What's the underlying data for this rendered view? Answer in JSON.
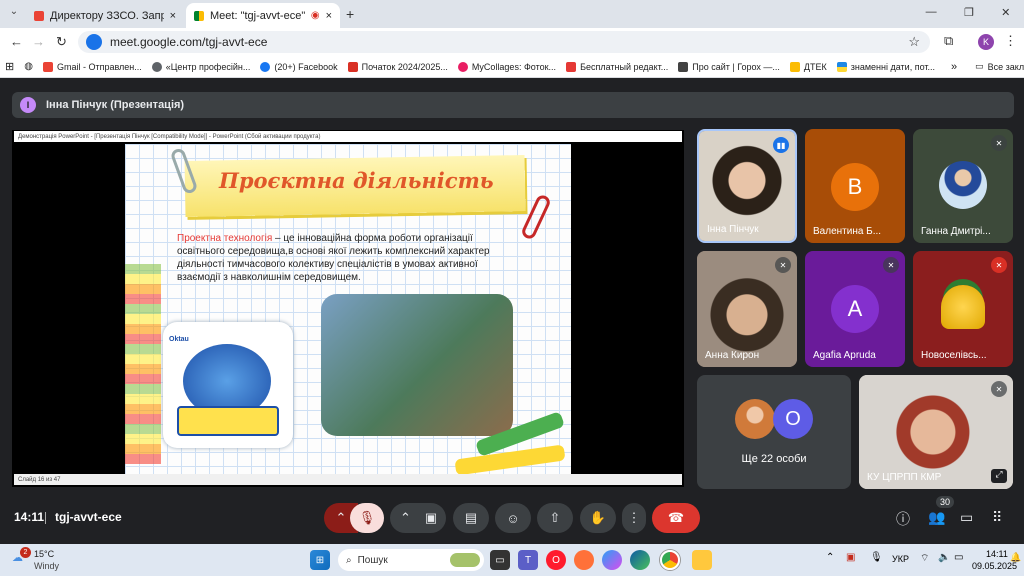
{
  "browser": {
    "tabs": [
      {
        "title": "Директору ЗЗСО. Запрошення",
        "close": "×"
      },
      {
        "title": "Meet: \"tgj-avvt-ece\"",
        "close": "×"
      }
    ],
    "new_tab": "+",
    "url": "meet.google.com/tgj-avvt-ece",
    "profile_initial": "K",
    "bookmarks": [
      {
        "label": "Gmail - Отправлен...",
        "color": "#ea4335"
      },
      {
        "label": "«Центр професійн...",
        "color": "#5f6368"
      },
      {
        "label": "(20+) Facebook",
        "color": "#1877f2"
      },
      {
        "label": "Початок 2024/2025...",
        "color": "#d93025"
      },
      {
        "label": "MyCollages: Фоток...",
        "color": "#e91e63"
      },
      {
        "label": "Бесплатный редакт...",
        "color": "#e53935"
      },
      {
        "label": "Про сайт | Горох —...",
        "color": "#424242"
      },
      {
        "label": "ДТЕК",
        "color": "#fbbc04"
      },
      {
        "label": "знаменні дати, пот...",
        "color": "#1e88e5"
      }
    ],
    "bookmarks_more": "»",
    "all_bookmarks": "Все закладки"
  },
  "meet": {
    "presenter_initial": "І",
    "presenter_label": "Інна Пінчук (Презентація)",
    "ppt_title": "Демонстрація PowerPoint - [Презентація Пінчук [Compatibility Mode]] - PowerPoint (Сбой активации продукта)",
    "ppt_status": "Слайд 16 из 47",
    "slide": {
      "title": "Проєктна діяльність",
      "term": "Проектна технологія",
      "body": " – це інноваційна форма роботи організації освітнього середовища,в основі якої лежить комплексний характер діяльності тимчасового колективу спеціалістів в умовах активної взаємодії з навколишнім середовищем.",
      "logo_text": "Oktau"
    },
    "participants": [
      {
        "name": "Інна Пінчук",
        "speaking": true
      },
      {
        "name": "Валентина Б...",
        "initial": "B",
        "color": "#e8710a",
        "bg": "#a84d07"
      },
      {
        "name": "Ганна Дмитрі..."
      },
      {
        "name": "Анна Кирон"
      },
      {
        "name": "Agafia Apruda",
        "initial": "A",
        "color": "#8430ce",
        "bg": "#6a1b9a"
      },
      {
        "name": "Новоселівсь..."
      },
      {
        "name": "Ще 22 особи",
        "initial": "O",
        "color": "#5e5ce6"
      },
      {
        "name": "КУ ЦПРПП КМР"
      }
    ],
    "time": "14:11",
    "meeting_code": "tgj-avvt-ece",
    "participants_count": "30"
  },
  "taskbar": {
    "weather_temp": "15°C",
    "weather_desc": "Windy",
    "weather_badge": "2",
    "search_placeholder": "Пошук",
    "lang": "УКР",
    "clock_time": "14:11",
    "clock_date": "09.05.2025"
  }
}
